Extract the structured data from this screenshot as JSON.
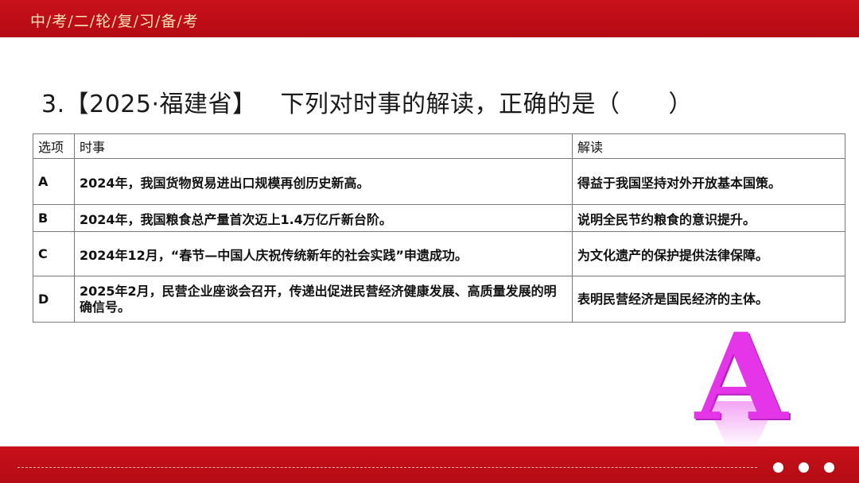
{
  "header": {
    "title": "中/考/二/轮/复/习/备/考"
  },
  "question": {
    "prefix": "3.【2025·福建省】",
    "text": "下列对时事的解读，正确的是（　　）"
  },
  "table": {
    "headers": [
      "选项",
      "时事",
      "解读"
    ],
    "rows": [
      {
        "option": "A",
        "event": "2024年，我国货物贸易进出口规模再创历史新高。",
        "interpretation": "得益于我国坚持对外开放基本国策。"
      },
      {
        "option": "B",
        "event": "2024年，我国粮食总产量首次迈上1.4万亿斤新台阶。",
        "interpretation": "说明全民节约粮食的意识提升。"
      },
      {
        "option": "C",
        "event": "2024年12月，“春节—中国人庆祝传统新年的社会实践”申遗成功。",
        "interpretation": "为文化遗产的保护提供法律保障。"
      },
      {
        "option": "D",
        "event": "2025年2月，民营企业座谈会召开，传递出促进民营经济健康发展、高质量发展的明确信号。",
        "interpretation": "表明民营经济是国民经济的主体。"
      }
    ]
  },
  "answer": {
    "letter": "A",
    "color": "#e436e8"
  },
  "colors": {
    "brand_red": "#c8101a",
    "header_text": "#fbe3b8"
  }
}
